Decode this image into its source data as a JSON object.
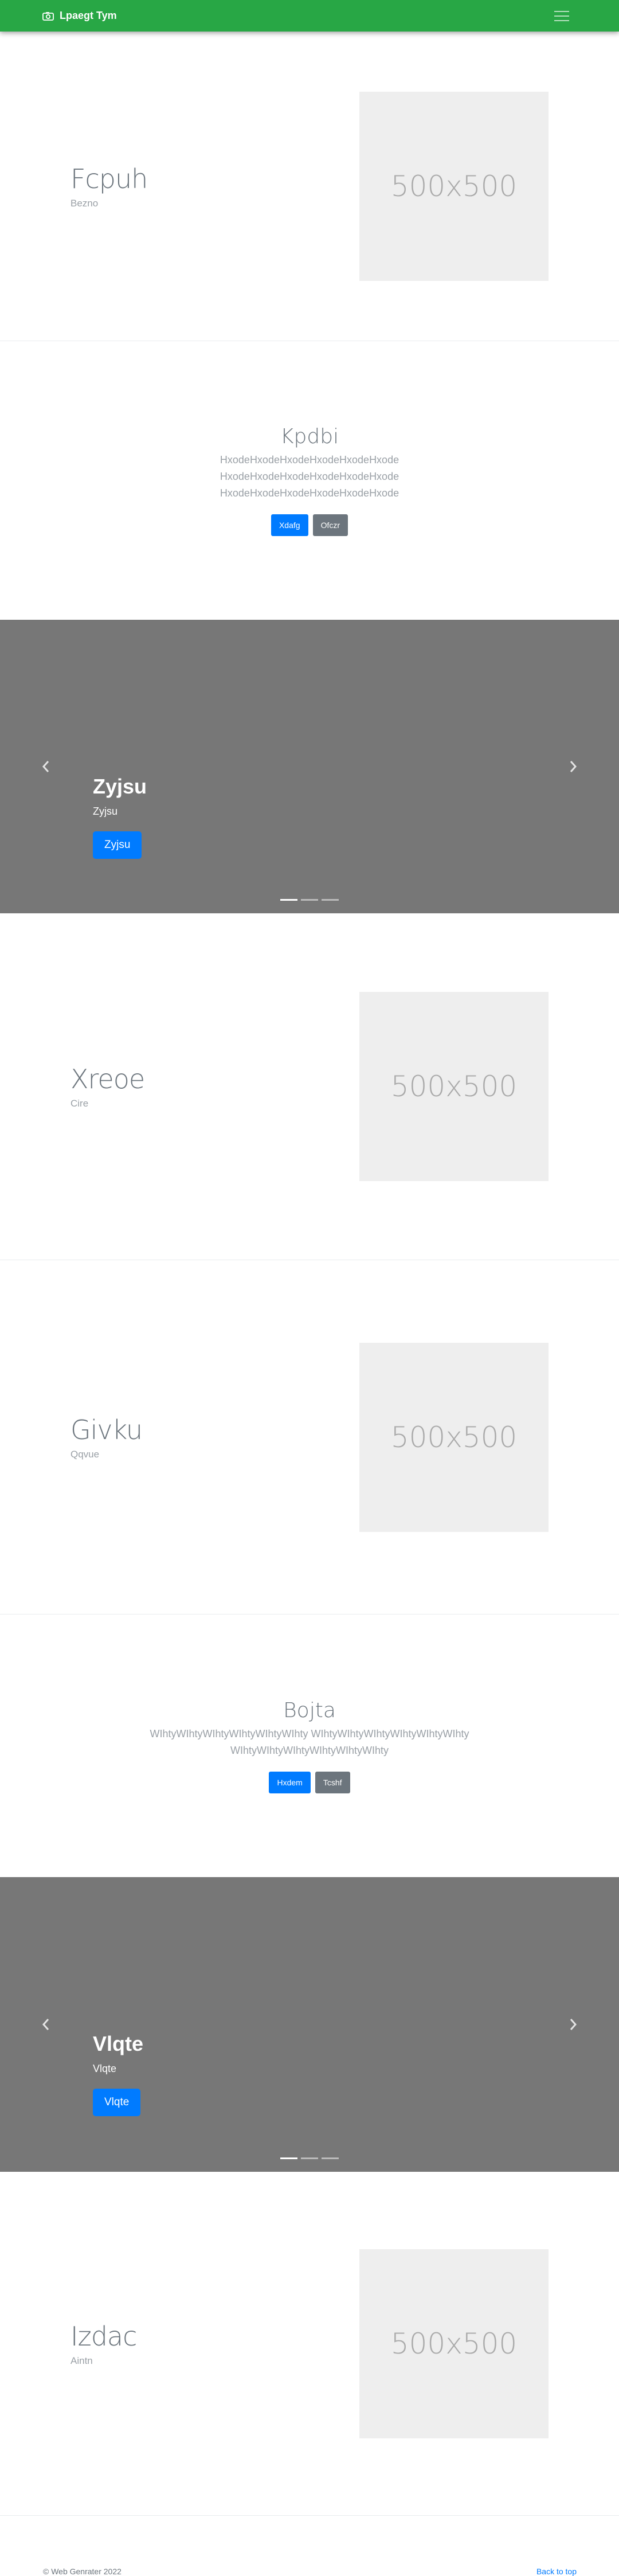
{
  "navbar": {
    "brand": "Lpaegt Tym",
    "brand_icon": "camera-icon",
    "toggler_icon": "hamburger-menu-icon",
    "background": "#28a745"
  },
  "sections": {
    "feature1": {
      "title": "Fcpuh",
      "subtitle": "Bezno",
      "image_label": "500x500"
    },
    "center1": {
      "title": "Kpdbi",
      "text": "HxodeHxodeHxodeHxodeHxodeHxode HxodeHxodeHxodeHxodeHxodeHxode HxodeHxodeHxodeHxodeHxodeHxode",
      "primary_label": "Xdafg",
      "secondary_label": "Ofczr"
    },
    "carousel1": {
      "title": "Zyjsu",
      "subtitle": "Zyjsu",
      "button_label": "Zyjsu"
    },
    "feature2": {
      "title": "Xreoe",
      "subtitle": "Cire",
      "image_label": "500x500"
    },
    "feature3": {
      "title": "Givku",
      "subtitle": "Qqvue",
      "image_label": "500x500"
    },
    "center2": {
      "title": "Bojta",
      "text": "WIhtyWIhtyWIhtyWIhtyWIhtyWIhty WIhtyWIhtyWIhtyWIhtyWIhtyWIhty WIhtyWIhtyWIhtyWIhtyWIhtyWIhty",
      "primary_label": "Hxdem",
      "secondary_label": "Tcshf"
    },
    "carousel2": {
      "title": "Vlqte",
      "subtitle": "Vlqte",
      "button_label": "Vlqte"
    },
    "feature4": {
      "title": "Izdac",
      "subtitle": "Aintn",
      "image_label": "500x500"
    }
  },
  "footer": {
    "copyright": "© Web Genrater 2022",
    "back_to_top": "Back to top"
  },
  "colors": {
    "primary": "#007bff",
    "secondary": "#6c757d",
    "carousel_bg": "#777777",
    "placeholder_bg": "#eeeeee"
  }
}
